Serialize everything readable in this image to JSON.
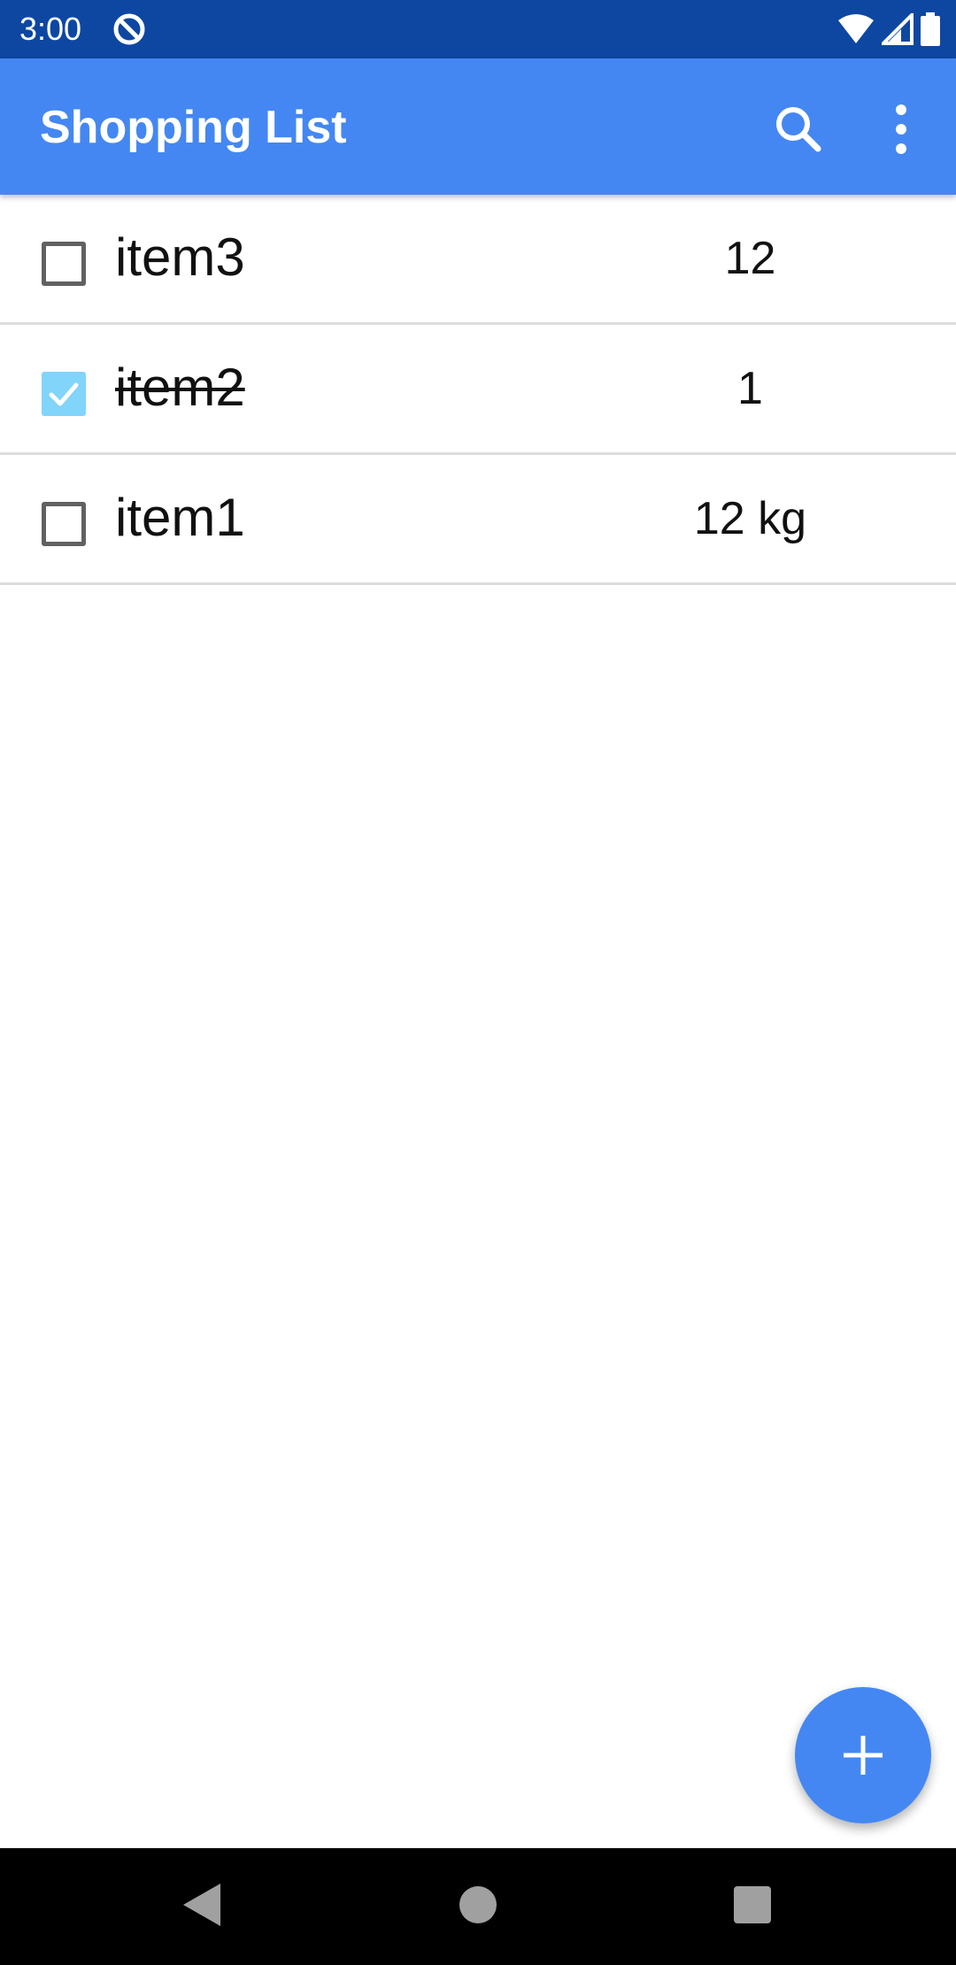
{
  "status_bar": {
    "time": "3:00",
    "icons": [
      "app-notification-icon",
      "wifi-icon",
      "cell-signal-icon",
      "battery-icon"
    ]
  },
  "app_bar": {
    "title": "Shopping List",
    "actions": [
      "search-icon",
      "more-vert-icon"
    ],
    "color": "#4487f2"
  },
  "items": [
    {
      "name": "item3",
      "quantity": "12",
      "checked": false
    },
    {
      "name": "item2",
      "quantity": "1",
      "checked": true
    },
    {
      "name": "item1",
      "quantity": "12 kg",
      "checked": false
    }
  ],
  "fab": {
    "icon": "plus-icon",
    "color": "#4487f2"
  },
  "nav_bar": {
    "buttons": [
      "back-icon",
      "home-icon",
      "recents-icon"
    ]
  }
}
